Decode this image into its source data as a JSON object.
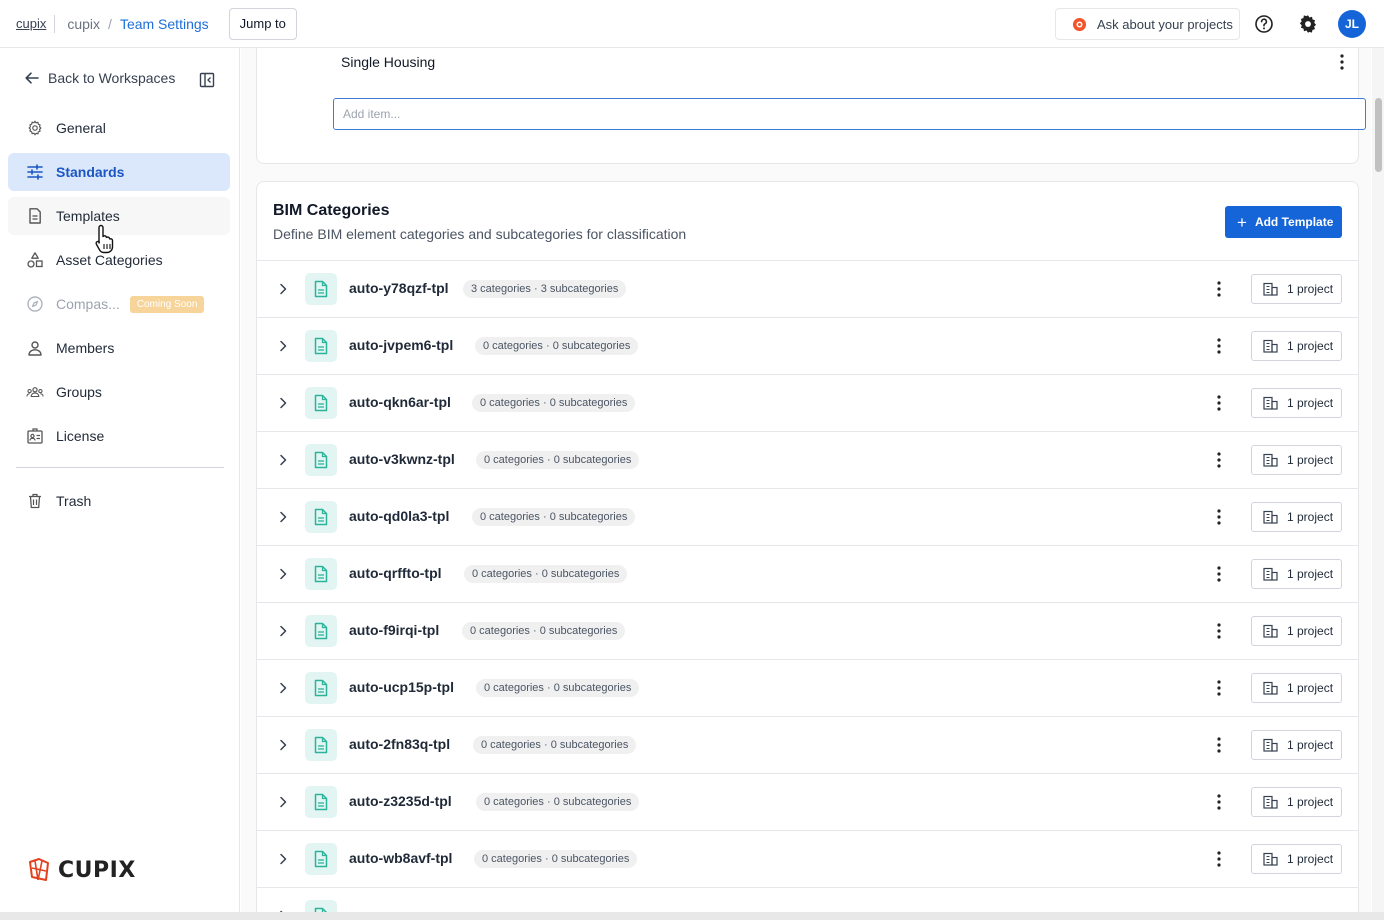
{
  "topbar": {
    "brand": "cupix",
    "workspace": "cupix",
    "separator": "/",
    "page": "Team Settings",
    "jump_label": "Jump to",
    "ask_label": "Ask about your projects",
    "avatar_initials": "JL"
  },
  "sidebar": {
    "back_label": "Back to Workspaces",
    "items": [
      {
        "label": "General",
        "icon": "gear-icon"
      },
      {
        "label": "Standards",
        "icon": "sliders-icon",
        "active": true
      },
      {
        "label": "Templates",
        "icon": "document-icon"
      },
      {
        "label": "Asset Categories",
        "icon": "shapes-icon"
      },
      {
        "label": "Compas...",
        "icon": "compass-icon",
        "disabled": true,
        "badge": "Coming Soon"
      },
      {
        "label": "Members",
        "icon": "person-icon"
      },
      {
        "label": "Groups",
        "icon": "group-icon"
      },
      {
        "label": "License",
        "icon": "license-icon"
      }
    ],
    "trash_label": "Trash",
    "logo_text": "CUPIX"
  },
  "list_card": {
    "item_label": "Single Housing",
    "add_placeholder": "Add item..."
  },
  "bim": {
    "title": "BIM Categories",
    "subtitle": "Define BIM element categories and subcategories for classification",
    "add_label": "Add Template",
    "templates": [
      {
        "name": "auto-y78qzf-tpl",
        "counts": "3 categories · 3 subcategories",
        "projects": "1 project"
      },
      {
        "name": "auto-jvpem6-tpl",
        "counts": "0 categories · 0 subcategories",
        "projects": "1 project"
      },
      {
        "name": "auto-qkn6ar-tpl",
        "counts": "0 categories · 0 subcategories",
        "projects": "1 project"
      },
      {
        "name": "auto-v3kwnz-tpl",
        "counts": "0 categories · 0 subcategories",
        "projects": "1 project"
      },
      {
        "name": "auto-qd0la3-tpl",
        "counts": "0 categories · 0 subcategories",
        "projects": "1 project"
      },
      {
        "name": "auto-qrffto-tpl",
        "counts": "0 categories · 0 subcategories",
        "projects": "1 project"
      },
      {
        "name": "auto-f9irqi-tpl",
        "counts": "0 categories · 0 subcategories",
        "projects": "1 project"
      },
      {
        "name": "auto-ucp15p-tpl",
        "counts": "0 categories · 0 subcategories",
        "projects": "1 project"
      },
      {
        "name": "auto-2fn83q-tpl",
        "counts": "0 categories · 0 subcategories",
        "projects": "1 project"
      },
      {
        "name": "auto-z3235d-tpl",
        "counts": "0 categories · 0 subcategories",
        "projects": "1 project"
      },
      {
        "name": "auto-wb8avf-tpl",
        "counts": "0 categories · 0 subcategories",
        "projects": "1 project"
      }
    ]
  },
  "colors": {
    "accent": "#1565d8",
    "active_bg": "#dbe8fb",
    "template_icon": "#2bb39b",
    "coming_soon": "#f7d49a"
  }
}
